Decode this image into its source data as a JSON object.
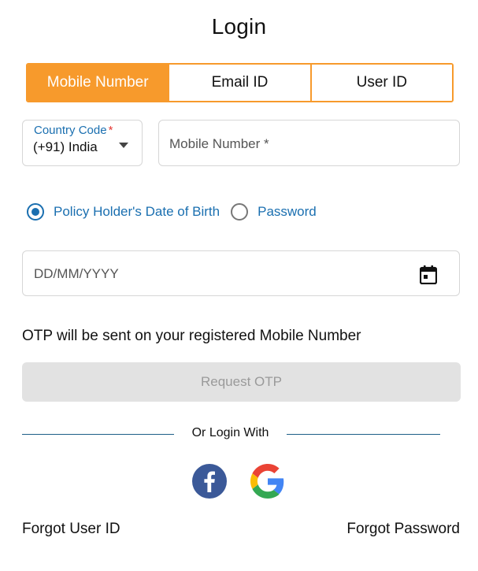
{
  "title": "Login",
  "tabs": [
    {
      "label": "Mobile Number",
      "active": true
    },
    {
      "label": "Email ID",
      "active": false
    },
    {
      "label": "User ID",
      "active": false
    }
  ],
  "country": {
    "label": "Country Code",
    "required_mark": "*",
    "value": "(+91) India"
  },
  "mobile": {
    "placeholder": "Mobile Number *"
  },
  "radios": [
    {
      "label": "Policy Holder's Date of Birth",
      "checked": true
    },
    {
      "label": "Password",
      "checked": false
    }
  ],
  "dob": {
    "placeholder": "DD/MM/YYYY",
    "icon": "calendar-icon"
  },
  "note": "OTP will be sent on your registered Mobile Number",
  "request_otp_label": "Request OTP",
  "divider_text": "Or Login With",
  "social": [
    {
      "icon": "facebook-icon",
      "color": "#3b5998"
    },
    {
      "icon": "google-icon",
      "colors": [
        "#4285F4",
        "#EA4335",
        "#FBBC05",
        "#34A853"
      ]
    }
  ],
  "links": {
    "forgot_user_id": "Forgot User ID",
    "forgot_password": "Forgot Password"
  },
  "colors": {
    "accent": "#f79a2c",
    "primary": "#1a6fb0",
    "divider": "#1d5e87"
  }
}
